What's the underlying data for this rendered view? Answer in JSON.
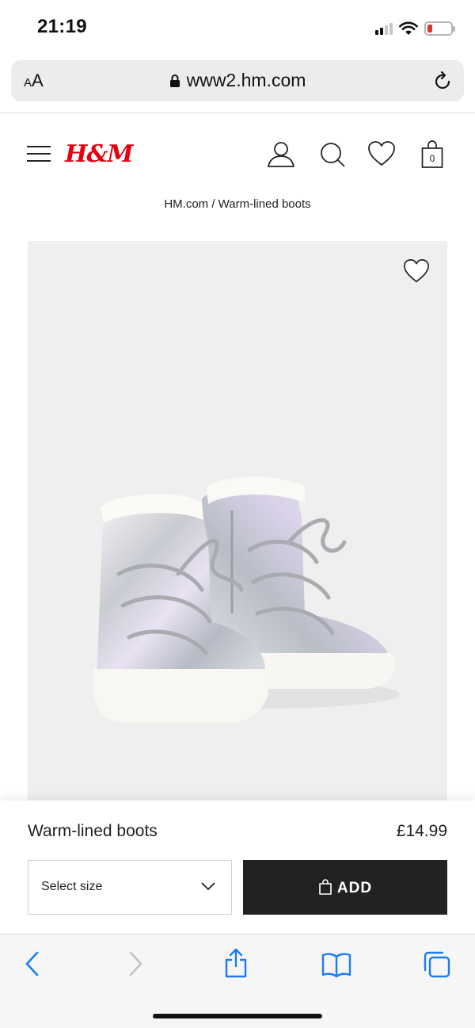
{
  "status_bar": {
    "time": "21:19",
    "battery_level": 0.15,
    "signal_bars_filled": 2,
    "signal_bars_total": 4
  },
  "browser": {
    "text_size_label": "AA",
    "url": "www2.hm.com"
  },
  "site": {
    "logo": "H&M",
    "header_icons": [
      "account-icon",
      "search-icon",
      "favourites-icon",
      "shopping-bag-icon"
    ],
    "bag_count": "0"
  },
  "breadcrumb": "HM.com / Warm-lined boots",
  "product": {
    "name": "Warm-lined boots",
    "price": "£14.99",
    "size_placeholder": "Select size",
    "add_label": "ADD"
  },
  "toolbar": {
    "items": [
      "back-icon",
      "forward-icon",
      "share-icon",
      "bookmarks-icon",
      "tabs-icon"
    ]
  },
  "colors": {
    "brand_red": "#e50010",
    "button_dark": "#222222",
    "ios_blue": "#1a7cf5"
  }
}
